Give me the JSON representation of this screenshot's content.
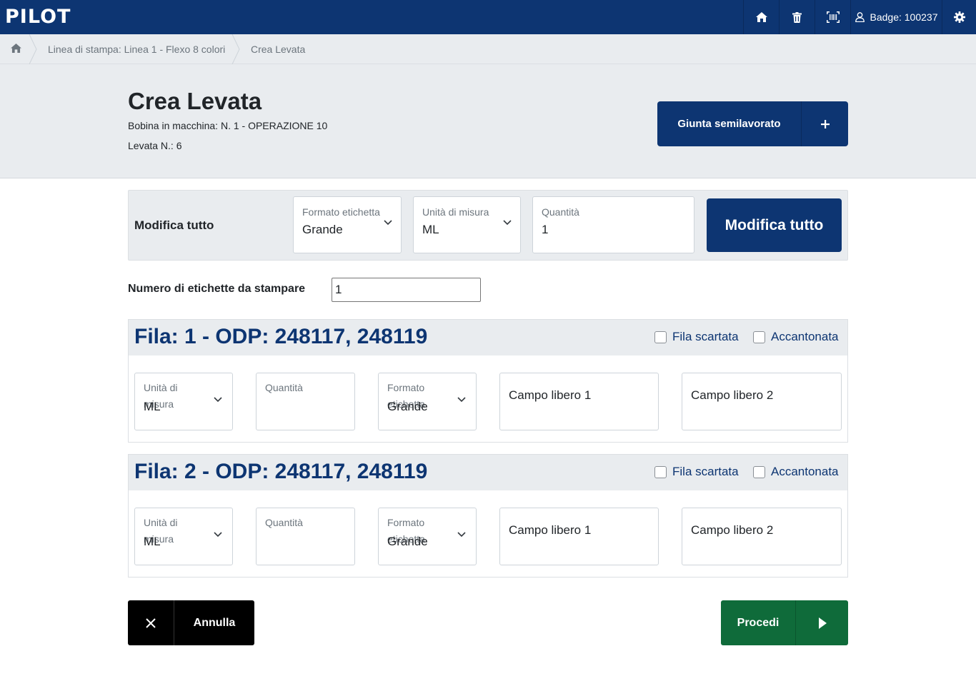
{
  "app": {
    "logo": "PILOT"
  },
  "topbar": {
    "home_icon": "home-icon",
    "trash_icon": "trash-icon",
    "barcode_icon": "barcode-icon",
    "badge_label": "Badge: 100237",
    "settings_icon": "gear-icon"
  },
  "breadcrumb": {
    "items": [
      "Linea di stampa: Linea 1 - Flexo 8 colori",
      "Crea Levata"
    ]
  },
  "header": {
    "title": "Crea Levata",
    "line1": "Bobina in macchina: N. 1 - OPERAZIONE 10",
    "line2": "Levata N.: 6",
    "giunta_label": "Giunta semilavorato"
  },
  "modifica": {
    "title": "Modifica tutto",
    "formato_label": "Formato etichetta",
    "formato_value": "Grande",
    "unita_label": "Unità di misura",
    "unita_value": "ML",
    "quantita_label": "Quantità",
    "quantita_value": "1",
    "button_label": "Modifica tutto"
  },
  "etichette": {
    "label": "Numero di etichette da stampare",
    "value": "1"
  },
  "rows": [
    {
      "title": "Fila: 1 - ODP: 248117, 248119",
      "scartata_label": "Fila scartata",
      "accantonata_label": "Accantonata",
      "unita_label": "Unità di misura",
      "unita_value": "ML",
      "quantita_label": "Quantità",
      "formato_label": "Formato etichetta",
      "formato_value": "Grande",
      "campo1": "Campo libero 1",
      "campo2": "Campo libero 2"
    },
    {
      "title": "Fila: 2 - ODP: 248117, 248119",
      "scartata_label": "Fila scartata",
      "accantonata_label": "Accantonata",
      "unita_label": "Unità di misura",
      "unita_value": "ML",
      "quantita_label": "Quantità",
      "formato_label": "Formato etichetta",
      "formato_value": "Grande",
      "campo1": "Campo libero 1",
      "campo2": "Campo libero 2"
    }
  ],
  "footer": {
    "annulla_label": "Annulla",
    "procedi_label": "Procedi"
  },
  "colors": {
    "primary": "#0d3572",
    "success": "#0f6b3a",
    "panel_bg": "#e9ecef"
  }
}
